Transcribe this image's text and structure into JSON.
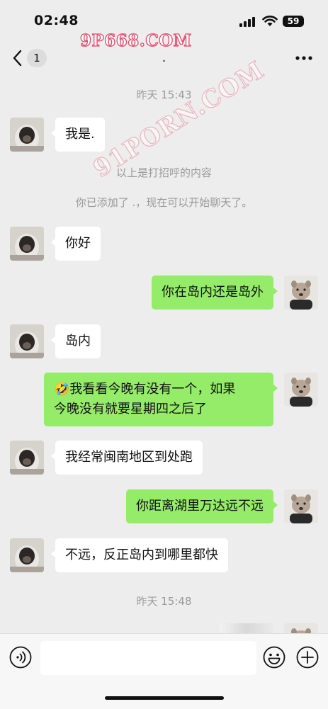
{
  "status": {
    "time": "02:48",
    "battery": "59"
  },
  "nav": {
    "unread_count": "1",
    "title": "."
  },
  "watermark": {
    "top": "9P668.COM",
    "diagonal": "91PORN.COM"
  },
  "timestamps": [
    "昨天 15:43",
    "昨天 15:48"
  ],
  "system_notes": [
    "以上是打招呼的内容",
    "你已添加了 .，现在可以开始聊天了。"
  ],
  "messages": [
    {
      "side": "in",
      "text": "我是."
    },
    {
      "side": "in",
      "text": "你好"
    },
    {
      "side": "out",
      "text": "你在岛内还是岛外"
    },
    {
      "side": "in",
      "text": "岛内"
    },
    {
      "side": "out",
      "emoji": "🤣",
      "line1": "我看看今晚有没有一个，如果",
      "line2": "今晚没有就要星期四之后了"
    },
    {
      "side": "in",
      "text": "我经常闽南地区到处跑"
    },
    {
      "side": "out",
      "text": "你距离湖里万达远不远"
    },
    {
      "side": "in",
      "text": "不远，反正岛内到哪里都快"
    }
  ],
  "icons": {
    "back": "chevron-left-icon",
    "more": "more-dots-icon",
    "voice": "voice-icon",
    "emoji": "emoji-icon",
    "plus": "plus-icon"
  },
  "colors": {
    "background": "#ededed",
    "outgoing_bubble": "#95ec69",
    "incoming_bubble": "#ffffff",
    "watermark": "#e34b6b"
  }
}
